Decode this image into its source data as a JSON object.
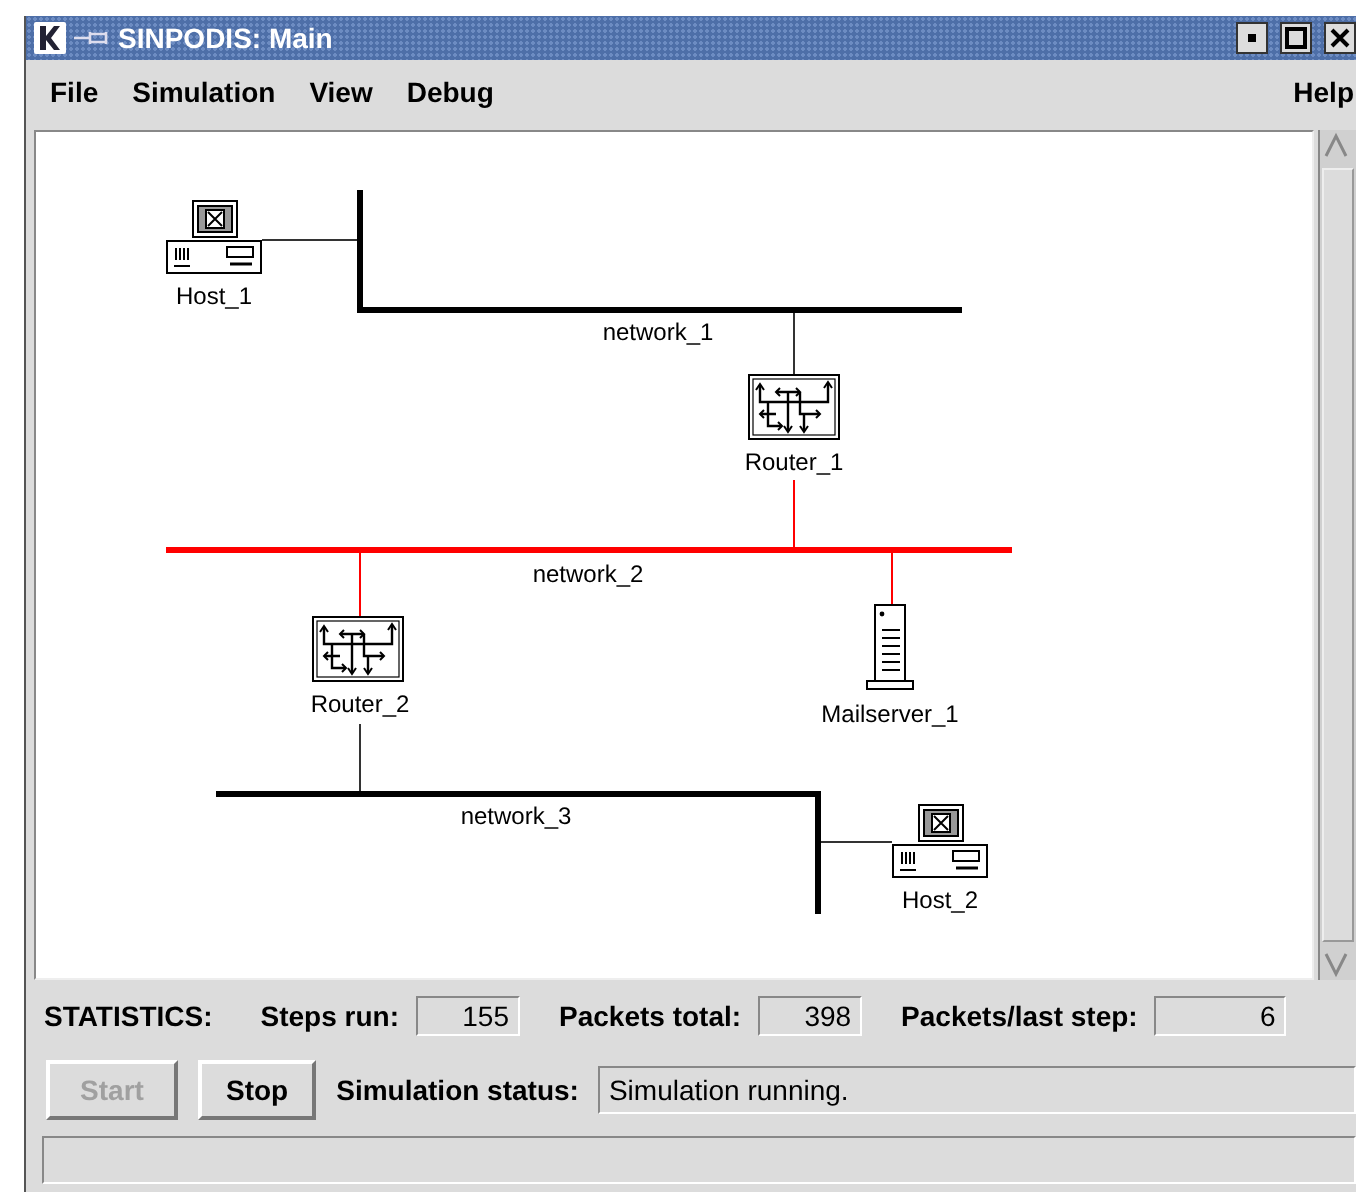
{
  "window": {
    "title": "SINPODIS: Main"
  },
  "menu": [
    {
      "label": "File"
    },
    {
      "label": "Simulation"
    },
    {
      "label": "View"
    },
    {
      "label": "Debug"
    },
    {
      "label": "Help"
    }
  ],
  "networks": [
    {
      "name": "network_1",
      "color": "#000000"
    },
    {
      "name": "network_2",
      "color": "#ff0000"
    },
    {
      "name": "network_3",
      "color": "#000000"
    }
  ],
  "nodes": [
    {
      "kind": "host",
      "name": "Host_1"
    },
    {
      "kind": "router",
      "name": "Router_1"
    },
    {
      "kind": "router",
      "name": "Router_2"
    },
    {
      "kind": "server",
      "name": "Mailserver_1"
    },
    {
      "kind": "host",
      "name": "Host_2"
    }
  ],
  "statistics": {
    "label": "STATISTICS:",
    "fields": [
      {
        "label": "Steps run:",
        "value": "155"
      },
      {
        "label": "Packets total:",
        "value": "398"
      },
      {
        "label": "Packets/last step:",
        "value": "6"
      }
    ]
  },
  "buttons": [
    {
      "label": "Start",
      "disabled": true
    },
    {
      "label": "Stop",
      "disabled": false
    }
  ],
  "simulation_status": {
    "label": "Simulation status:",
    "value": "Simulation running."
  }
}
